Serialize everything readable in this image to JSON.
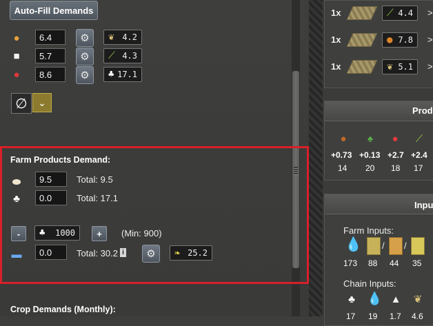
{
  "toolbar": {
    "autofill_label": "Auto-Fill Demands"
  },
  "top_resources": [
    {
      "icon": "bread-icon",
      "value": "6.4",
      "badge_icon": "wheat-icon",
      "badge_value": "4.2"
    },
    {
      "icon": "sugar-icon",
      "value": "5.7",
      "badge_icon": "sugarcane-icon",
      "badge_value": "4.3"
    },
    {
      "icon": "meat-icon",
      "value": "8.6",
      "badge_icon": "chicken-icon",
      "badge_value": "17.1"
    }
  ],
  "farm_products": {
    "heading": "Farm Products Demand:",
    "rows": [
      {
        "icon": "eggs-icon",
        "value": "9.5",
        "total": "Total: 9.5"
      },
      {
        "icon": "chicken-icon",
        "value": "0.0",
        "total": "Total: 17.1"
      }
    ],
    "animals": {
      "minus": "-",
      "plus": "+",
      "count": "1000",
      "min": "(Min: 900)"
    },
    "feed": {
      "value": "0.0",
      "total": "Total: 30.2",
      "info": "i",
      "badge_value": "25.2"
    }
  },
  "crop_demands_heading": "Crop Demands (Monthly):",
  "right": {
    "recipes": [
      {
        "qty": "1x",
        "badge_value": "4.4",
        "arrow": ">"
      },
      {
        "qty": "1x",
        "badge_value": "7.8",
        "arrow": ">"
      },
      {
        "qty": "1x",
        "badge_value": "5.1",
        "arrow": ">"
      }
    ],
    "production": {
      "title": "Produ",
      "items": [
        {
          "delta": "+0.73",
          "count": "14"
        },
        {
          "delta": "+0.13",
          "count": "20"
        },
        {
          "delta": "+2.7",
          "count": "18"
        },
        {
          "delta": "+2.4",
          "count": "17"
        }
      ]
    },
    "inputs": {
      "title": "Input",
      "farm_label": "Farm Inputs:",
      "farm_values": [
        "173",
        "88",
        "44",
        "35"
      ],
      "sep": "/",
      "chain_label": "Chain Inputs:",
      "chain_values": [
        "17",
        "19",
        "1.7",
        "4.6"
      ]
    }
  },
  "colors": {
    "highlight": "#d8202a",
    "button": "#5c646c"
  }
}
